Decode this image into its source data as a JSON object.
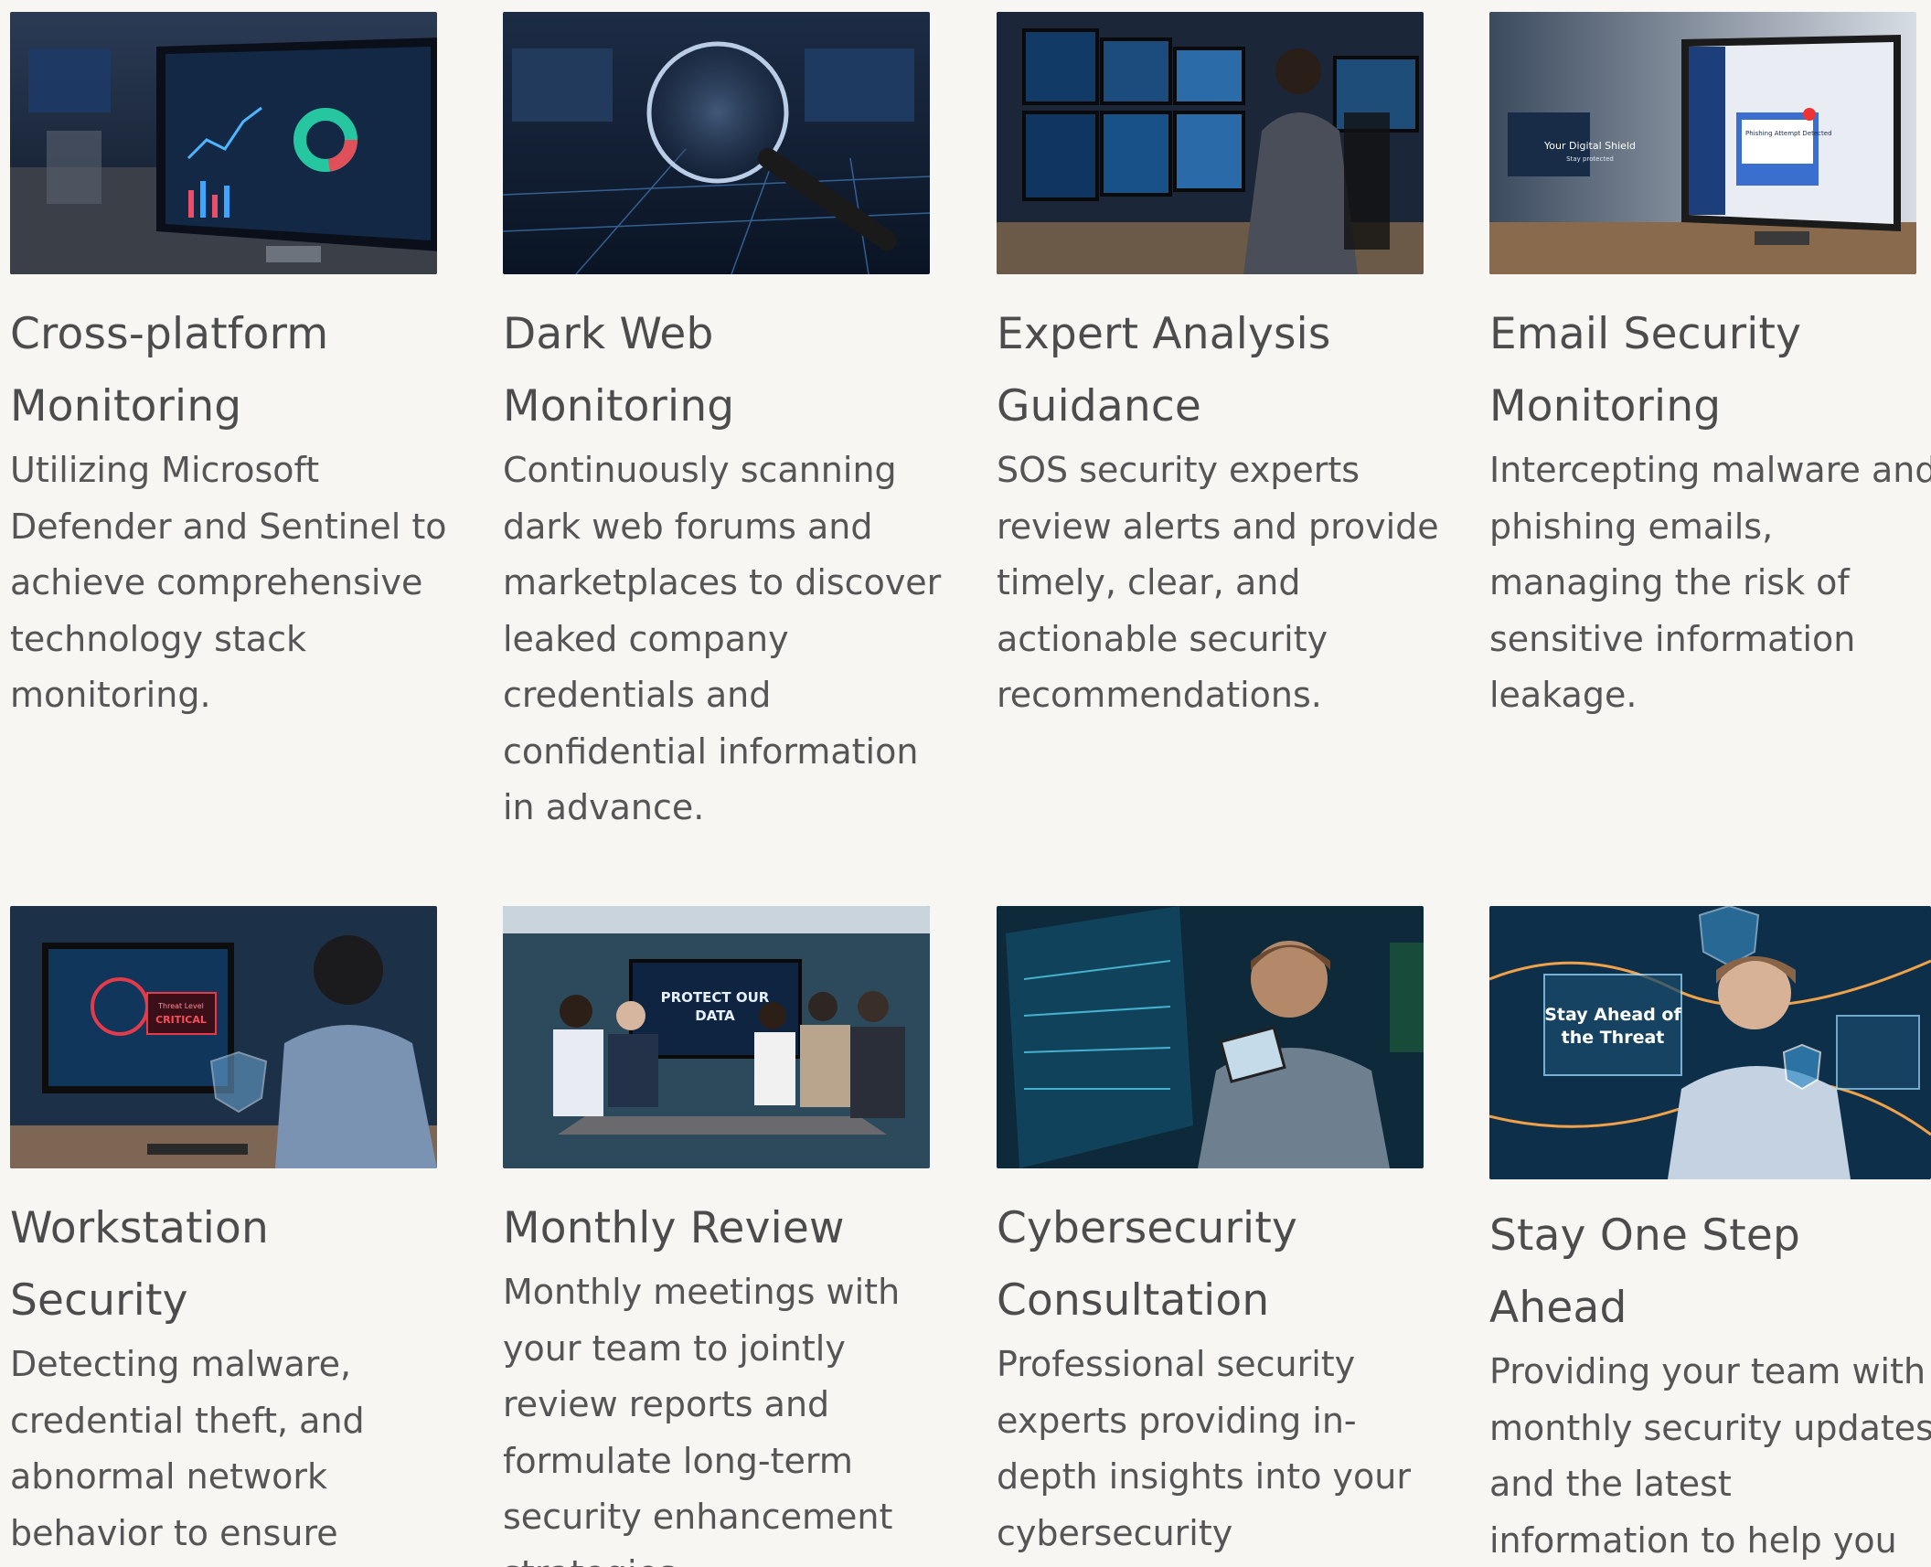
{
  "cards": [
    {
      "title": "Cross-platform Monitoring",
      "description": "Utilizing Microsoft Defender and Sentinel to achieve comprehensive technology stack monitoring.",
      "image": "security-dashboard-monitor-photo"
    },
    {
      "title": "Dark Web Monitoring",
      "description": "Continuously scanning dark web forums and marketplaces to discover leaked company credentials and confidential information in advance.",
      "image": "magnifying-glass-data-photo"
    },
    {
      "title": "Expert Analysis Guidance",
      "description": "SOS security experts review alerts and provide timely, clear, and actionable security recommendations.",
      "image": "analyst-multi-monitor-photo"
    },
    {
      "title": "Email Security Monitoring",
      "description": "Intercepting malware and phishing emails, managing the risk of sensitive information leakage.",
      "image": "phishing-alert-monitor-photo",
      "image_text": [
        "Your Digital Shield",
        "Stay protected",
        "Phishing Attempt Detected"
      ]
    },
    {
      "title": "Workstation Security",
      "description": "Detecting malware, credential theft, and abnormal network behavior to ensure system security.",
      "image": "workstation-critical-alert-photo",
      "image_text": [
        "Threat Level",
        "CRITICAL"
      ]
    },
    {
      "title": "Monthly Review",
      "description": "Monthly meetings with your team to jointly review reports and formulate long-term security enhancement strategies.",
      "image": "team-meeting-photo",
      "image_text": [
        "PROTECT OUR",
        "DATA"
      ]
    },
    {
      "title": "Cybersecurity Consultation",
      "description": "Professional security experts providing in-depth insights into your cybersecurity environment.",
      "image": "consultant-tablet-photo"
    },
    {
      "title": "Stay One Step Ahead",
      "description": "Providing your team with monthly security updates and the latest information to help you stay one step ahead.",
      "image": "stay-ahead-hologram-photo",
      "image_text": [
        "Stay Ahead of",
        "the Threat"
      ]
    }
  ]
}
